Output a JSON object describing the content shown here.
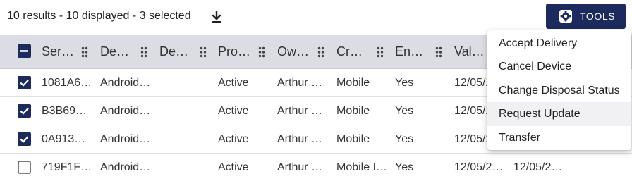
{
  "toolbar": {
    "results_text": "10 results - 10 displayed - 3 selected",
    "download_icon": "download-icon",
    "tools_label": "TOOLS",
    "tools_icon": "gear-icon",
    "accent_color": "#1c2a5e"
  },
  "table": {
    "headers": [
      "Ser…",
      "De…",
      "De…",
      "Pro…",
      "Ow…",
      "Cr…",
      "En…",
      "Val…"
    ],
    "rows": [
      {
        "checked": true,
        "serial": "1081A6…",
        "device": "Android…",
        "desc": "",
        "status": "Active",
        "owner": "Arthur …",
        "created": "Mobile",
        "enabled": "Yes",
        "valid": "12/05/2…",
        "extra": ""
      },
      {
        "checked": true,
        "serial": "B3B69…",
        "device": "Android…",
        "desc": "",
        "status": "Active",
        "owner": "Arthur …",
        "created": "Mobile",
        "enabled": "Yes",
        "valid": "12/05/2…",
        "extra": ""
      },
      {
        "checked": true,
        "serial": "0A913…",
        "device": "Android…",
        "desc": "",
        "status": "Active",
        "owner": "Arthur …",
        "created": "Mobile",
        "enabled": "Yes",
        "valid": "12/05/2…",
        "extra": ""
      },
      {
        "checked": false,
        "serial": "719F1F…",
        "device": "Android…",
        "desc": "",
        "status": "Active",
        "owner": "Arthur …",
        "created": "Mobile I…",
        "enabled": "Yes",
        "valid": "12/05/2…",
        "extra": "12/05/2…"
      }
    ]
  },
  "menu": {
    "items": [
      "Accept Delivery",
      "Cancel Device",
      "Change Disposal Status",
      "Request Update",
      "Transfer"
    ],
    "hovered": "Request Update"
  }
}
